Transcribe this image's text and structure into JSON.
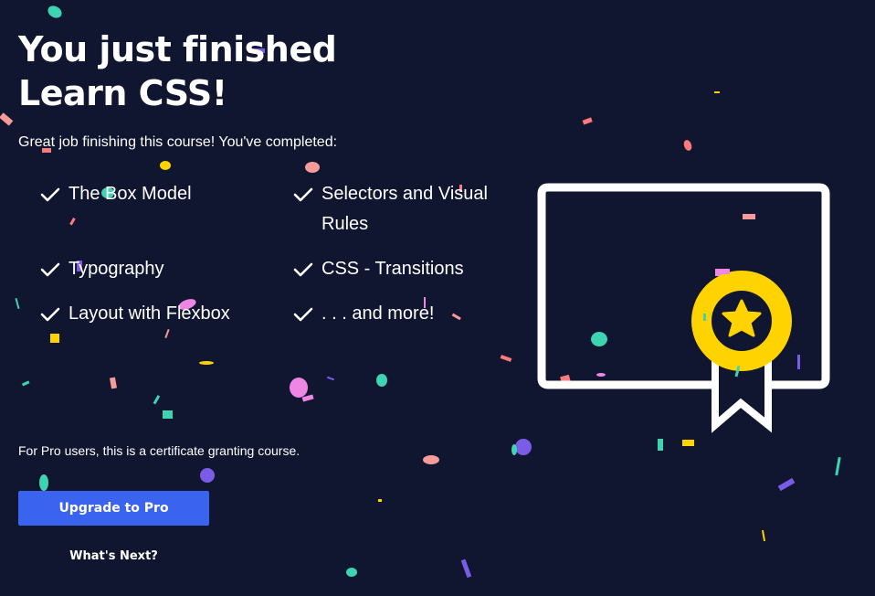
{
  "heading": {
    "line1": "You just finished",
    "line2": "Learn CSS!"
  },
  "intro_text": "Great job finishing this course! You've completed:",
  "completed_items": [
    "The Box Model",
    "Selectors and Visual Rules",
    "Typography",
    "CSS - Transitions",
    "Layout with Flexbox",
    ". . . and more!"
  ],
  "pro_note": "For Pro users, this is a certificate granting course.",
  "upgrade_button_label": "Upgrade to Pro",
  "whats_next_label": "What's Next?",
  "icons": {
    "check": "check-icon",
    "certificate": "certificate-icon",
    "award": "award-ribbon-icon",
    "star": "star-icon"
  },
  "colors": {
    "background": "#10162f",
    "text": "#ffffff",
    "button": "#3a63f0",
    "badge": "#ffd300",
    "confetti": [
      "#3ed4b2",
      "#f79a9a",
      "#7b5ce7",
      "#ffd300",
      "#ee86e6",
      "#ff7a7a"
    ]
  }
}
